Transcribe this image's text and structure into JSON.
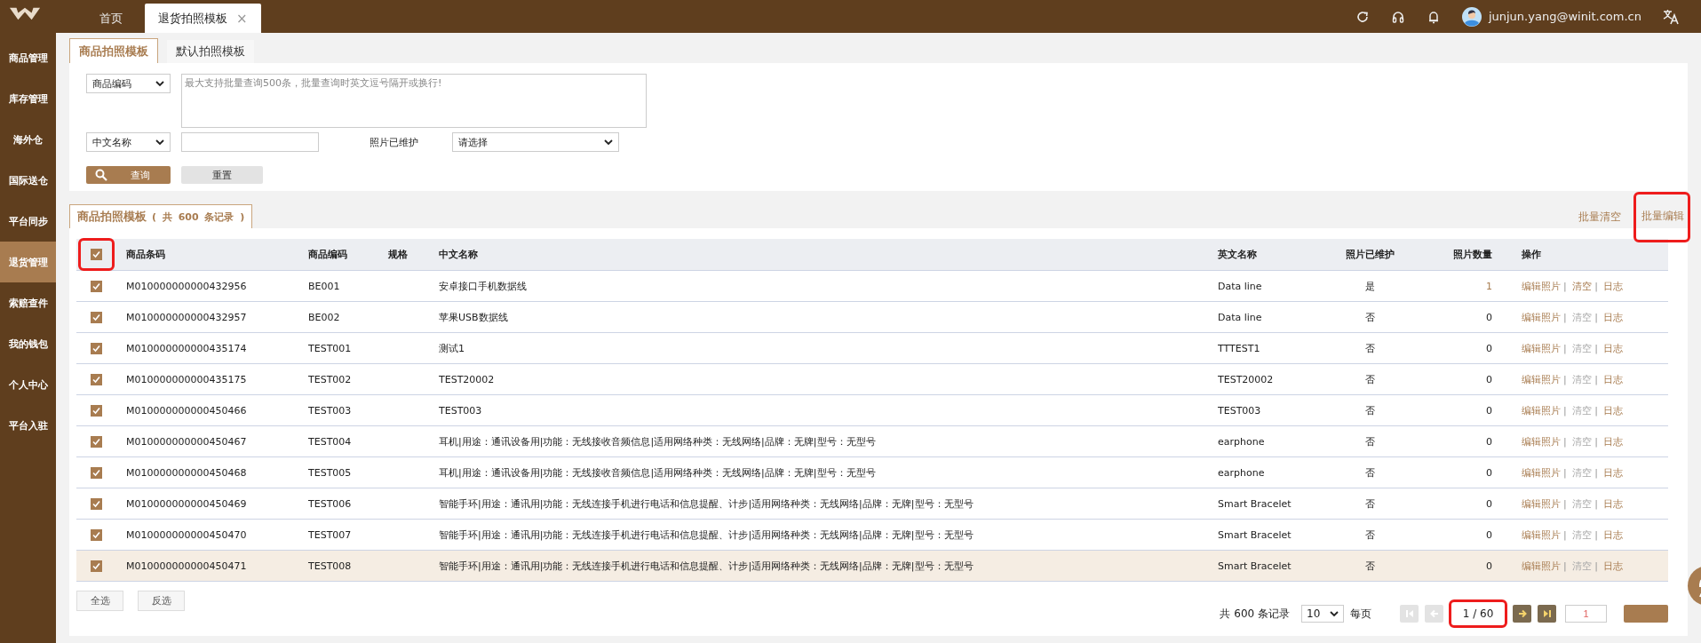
{
  "top_tabs": [
    {
      "label": "首页",
      "selected": false
    },
    {
      "label": "退货拍照模板",
      "selected": true,
      "close": "×"
    }
  ],
  "user": {
    "email": "junjun.yang@winit.com.cn"
  },
  "sidebar": {
    "items": [
      {
        "label": "商品管理",
        "selected": false
      },
      {
        "label": "库存管理",
        "selected": false
      },
      {
        "label": "海外仓",
        "selected": false
      },
      {
        "label": "国际送仓",
        "selected": false
      },
      {
        "label": "平台同步",
        "selected": false
      },
      {
        "label": "退货管理",
        "selected": true
      },
      {
        "label": "索赔查件",
        "selected": false
      },
      {
        "label": "我的钱包",
        "selected": false
      },
      {
        "label": "个人中心",
        "selected": false
      },
      {
        "label": "平台入驻",
        "selected": false
      }
    ]
  },
  "page_tabs": [
    {
      "label": "商品拍照模板",
      "selected": true
    },
    {
      "label": "默认拍照模板",
      "selected": false
    }
  ],
  "filters": {
    "code_type": "商品编码",
    "codes_placeholder": "最大支持批量查询500条，批量查询时英文逗号隔开或换行!",
    "name_type": "中文名称",
    "photo_label": "照片已维护",
    "photo_select": "请选择",
    "query_button": "查询",
    "reset_button": "重置"
  },
  "results": {
    "tab_label": "商品拍照模板",
    "tab_count": "( 共 **600** 条记录 )",
    "actions": [
      {
        "label": "批量清空",
        "highlighted": false
      },
      {
        "label": "批量编辑",
        "highlighted": true
      }
    ]
  },
  "table": {
    "separator": "|",
    "header_checked": true,
    "header_highlighted": true,
    "columns": [
      "商品条码",
      "商品编码",
      "规格",
      "中文名称",
      "英文名称",
      "照片已维护",
      "照片数量",
      "操作"
    ],
    "rows": [
      {
        "checked": true,
        "selected": false,
        "barcode": "M010000000000432956",
        "code": "BE001",
        "name_cn": "安卓接口手机数据线",
        "name_en": "Data line",
        "maintained": "是",
        "count": "1",
        "count_linked": true,
        "actions": [
          {
            "label": "编辑照片",
            "disabled": false
          },
          {
            "label": "清空",
            "disabled": false
          },
          {
            "label": "日志",
            "disabled": false
          }
        ]
      },
      {
        "checked": true,
        "selected": false,
        "barcode": "M010000000000432957",
        "code": "BE002",
        "name_cn": "苹果USB数据线",
        "name_en": "Data line",
        "maintained": "否",
        "count": "0",
        "count_linked": false,
        "actions": [
          {
            "label": "编辑照片",
            "disabled": false
          },
          {
            "label": "清空",
            "disabled": true
          },
          {
            "label": "日志",
            "disabled": false
          }
        ]
      },
      {
        "checked": true,
        "selected": false,
        "barcode": "M010000000000435174",
        "code": "TEST001",
        "name_cn": "测试1",
        "name_en": "TTTEST1",
        "maintained": "否",
        "count": "0",
        "count_linked": false,
        "actions": [
          {
            "label": "编辑照片",
            "disabled": false
          },
          {
            "label": "清空",
            "disabled": true
          },
          {
            "label": "日志",
            "disabled": false
          }
        ]
      },
      {
        "checked": true,
        "selected": false,
        "barcode": "M010000000000435175",
        "code": "TEST002",
        "name_cn": "TEST20002",
        "name_en": "TEST20002",
        "maintained": "否",
        "count": "0",
        "count_linked": false,
        "actions": [
          {
            "label": "编辑照片",
            "disabled": false
          },
          {
            "label": "清空",
            "disabled": true
          },
          {
            "label": "日志",
            "disabled": false
          }
        ]
      },
      {
        "checked": true,
        "selected": false,
        "barcode": "M010000000000450466",
        "code": "TEST003",
        "name_cn": "TEST003",
        "name_en": "TEST003",
        "maintained": "否",
        "count": "0",
        "count_linked": false,
        "actions": [
          {
            "label": "编辑照片",
            "disabled": false
          },
          {
            "label": "清空",
            "disabled": true
          },
          {
            "label": "日志",
            "disabled": false
          }
        ]
      },
      {
        "checked": true,
        "selected": false,
        "barcode": "M010000000000450467",
        "code": "TEST004",
        "name_cn": "耳机|用途：通讯设备用|功能：无线接收音频信息|适用网络种类：无线网络|品牌：无牌|型号：无型号",
        "name_en": "earphone",
        "maintained": "否",
        "count": "0",
        "count_linked": false,
        "actions": [
          {
            "label": "编辑照片",
            "disabled": false
          },
          {
            "label": "清空",
            "disabled": true
          },
          {
            "label": "日志",
            "disabled": false
          }
        ]
      },
      {
        "checked": true,
        "selected": false,
        "barcode": "M010000000000450468",
        "code": "TEST005",
        "name_cn": "耳机|用途：通讯设备用|功能：无线接收音频信息|适用网络种类：无线网络|品牌：无牌|型号：无型号",
        "name_en": "earphone",
        "maintained": "否",
        "count": "0",
        "count_linked": false,
        "actions": [
          {
            "label": "编辑照片",
            "disabled": false
          },
          {
            "label": "清空",
            "disabled": true
          },
          {
            "label": "日志",
            "disabled": false
          }
        ]
      },
      {
        "checked": true,
        "selected": false,
        "barcode": "M010000000000450469",
        "code": "TEST006",
        "name_cn": "智能手环|用途：通讯用|功能：无线连接手机进行电话和信息提醒、计步|适用网络种类：无线网络|品牌：无牌|型号：无型号",
        "name_en": "Smart Bracelet",
        "maintained": "否",
        "count": "0",
        "count_linked": false,
        "actions": [
          {
            "label": "编辑照片",
            "disabled": false
          },
          {
            "label": "清空",
            "disabled": true
          },
          {
            "label": "日志",
            "disabled": false
          }
        ]
      },
      {
        "checked": true,
        "selected": false,
        "barcode": "M010000000000450470",
        "code": "TEST007",
        "name_cn": "智能手环|用途：通讯用|功能：无线连接手机进行电话和信息提醒、计步|适用网络种类：无线网络|品牌：无牌|型号：无型号",
        "name_en": "Smart Bracelet",
        "maintained": "否",
        "count": "0",
        "count_linked": false,
        "actions": [
          {
            "label": "编辑照片",
            "disabled": false
          },
          {
            "label": "清空",
            "disabled": true
          },
          {
            "label": "日志",
            "disabled": false
          }
        ]
      },
      {
        "checked": true,
        "selected": true,
        "barcode": "M010000000000450471",
        "code": "TEST008",
        "name_cn": "智能手环|用途：通讯用|功能：无线连接手机进行电话和信息提醒、计步|适用网络种类：无线网络|品牌：无牌|型号：无型号",
        "name_en": "Smart Bracelet",
        "maintained": "否",
        "count": "0",
        "count_linked": false,
        "actions": [
          {
            "label": "编辑照片",
            "disabled": false
          },
          {
            "label": "清空",
            "disabled": true
          },
          {
            "label": "日志",
            "disabled": false
          }
        ]
      }
    ]
  },
  "footer_buttons": [
    "全选",
    "反选"
  ],
  "pagination": {
    "total": "共 600 条记录",
    "page_size": "10",
    "per_page": "每页",
    "page": "1 / 60",
    "page_highlighted": true,
    "first_disabled": true,
    "prev_disabled": true,
    "next_disabled": false,
    "last_disabled": false,
    "jump_value": "1"
  }
}
